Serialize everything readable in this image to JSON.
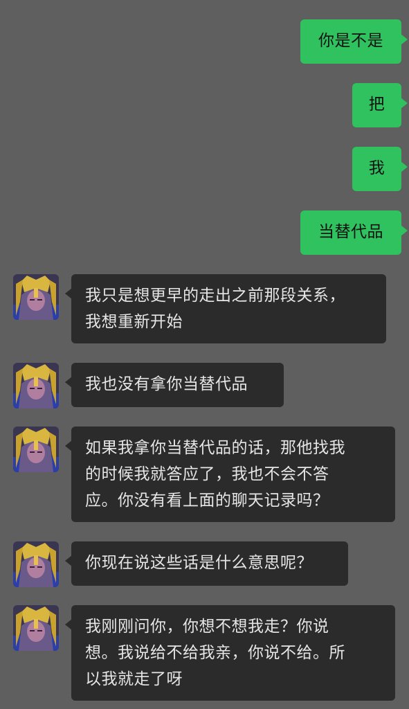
{
  "messages": [
    {
      "side": "out",
      "text": "你是不是"
    },
    {
      "side": "out",
      "text": "把"
    },
    {
      "side": "out",
      "text": "我"
    },
    {
      "side": "out",
      "text": "当替代品"
    },
    {
      "side": "in",
      "text": "我只是想更早的走出之前那段关系，\n我想重新开始"
    },
    {
      "side": "in",
      "text": "我也没有拿你当替代品"
    },
    {
      "side": "in",
      "text": "如果我拿你当替代品的话，那他找我\n的时候我就答应了，我也不会不答\n应。你没有看上面的聊天记录吗？"
    },
    {
      "side": "in",
      "text": "你现在说这些话是什么意思呢？"
    },
    {
      "side": "in",
      "text": "我刚刚问你，你想不想我走？你说\n想。我说给不给我亲，你说不给。所\n以我就走了呀"
    }
  ],
  "colors": {
    "background": "#5f5f5f",
    "outgoing_bubble": "#2fc25f",
    "incoming_bubble": "#2b2b2b",
    "incoming_text": "#e6e6e6"
  },
  "avatar_icon": "anime-character-avatar"
}
